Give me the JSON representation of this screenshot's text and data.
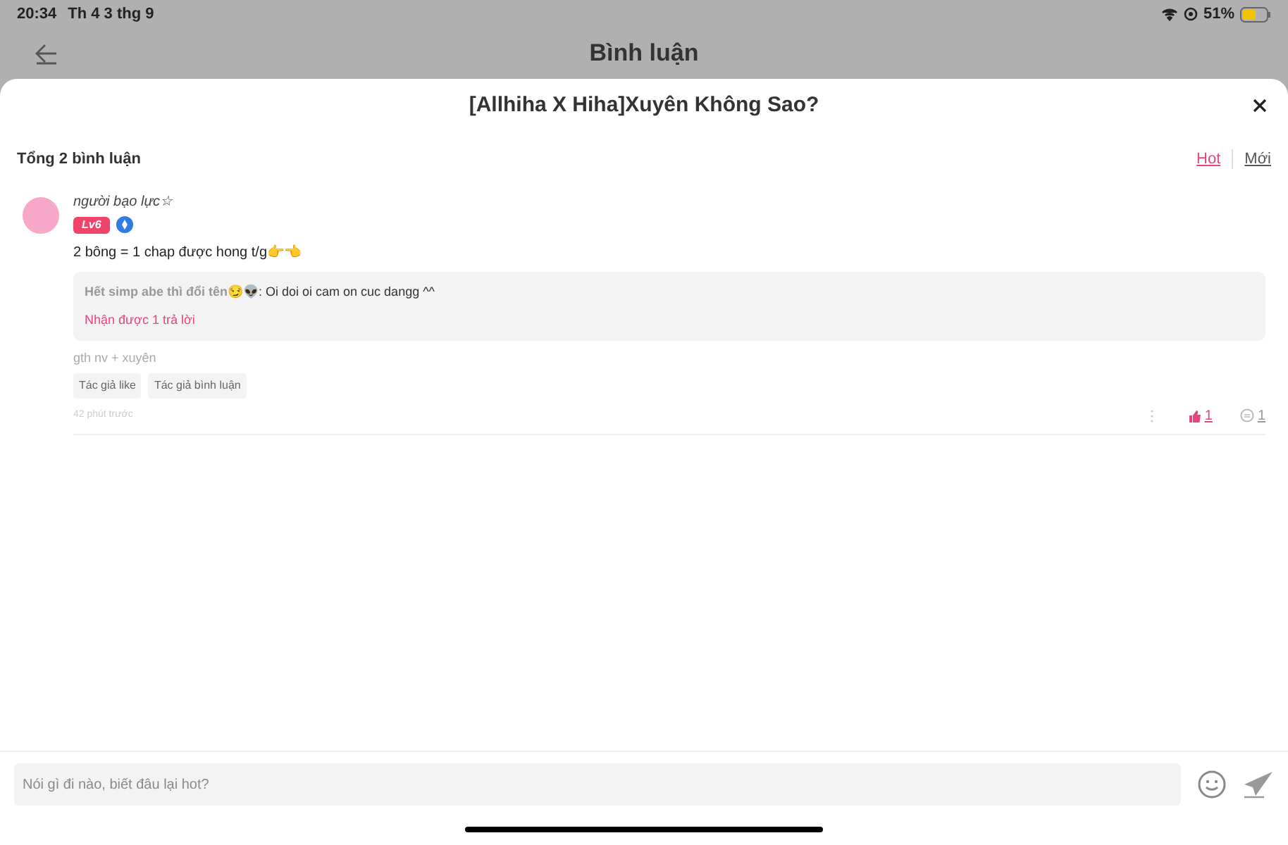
{
  "status_bar": {
    "time": "20:34",
    "date": "Th 4 3 thg 9",
    "battery": "51%"
  },
  "nav": {
    "title": "Bình luận"
  },
  "sheet": {
    "title": "[Allhiha X Hiha]Xuyên Không Sao?"
  },
  "header": {
    "total": "Tổng 2 bình luận",
    "sort_tabs": [
      {
        "label": "Hot",
        "selected": true
      },
      {
        "label": "Mới",
        "selected": false
      }
    ]
  },
  "comments": [
    {
      "author": "người bạo lực☆",
      "level_badge": "Lv6",
      "text": "2 bông = 1 chap được hong t/g👉👈",
      "replies": [
        {
          "author": "Hết simp abe thì đổi tên😏👽",
          "text": ": Oi doi oi cam on cuc dangg ^^"
        }
      ],
      "reply_count": "Nhận được 1 trả lời",
      "note": "gth nv + xuyên",
      "tags": [
        "Tác giả like",
        "Tác giả bình luận"
      ],
      "time": "42 phút trước",
      "likes": "1",
      "liked": true,
      "reply_total": "1"
    }
  ],
  "input": {
    "placeholder": "Nói gì đi nào, biết đâu lại hot?"
  }
}
